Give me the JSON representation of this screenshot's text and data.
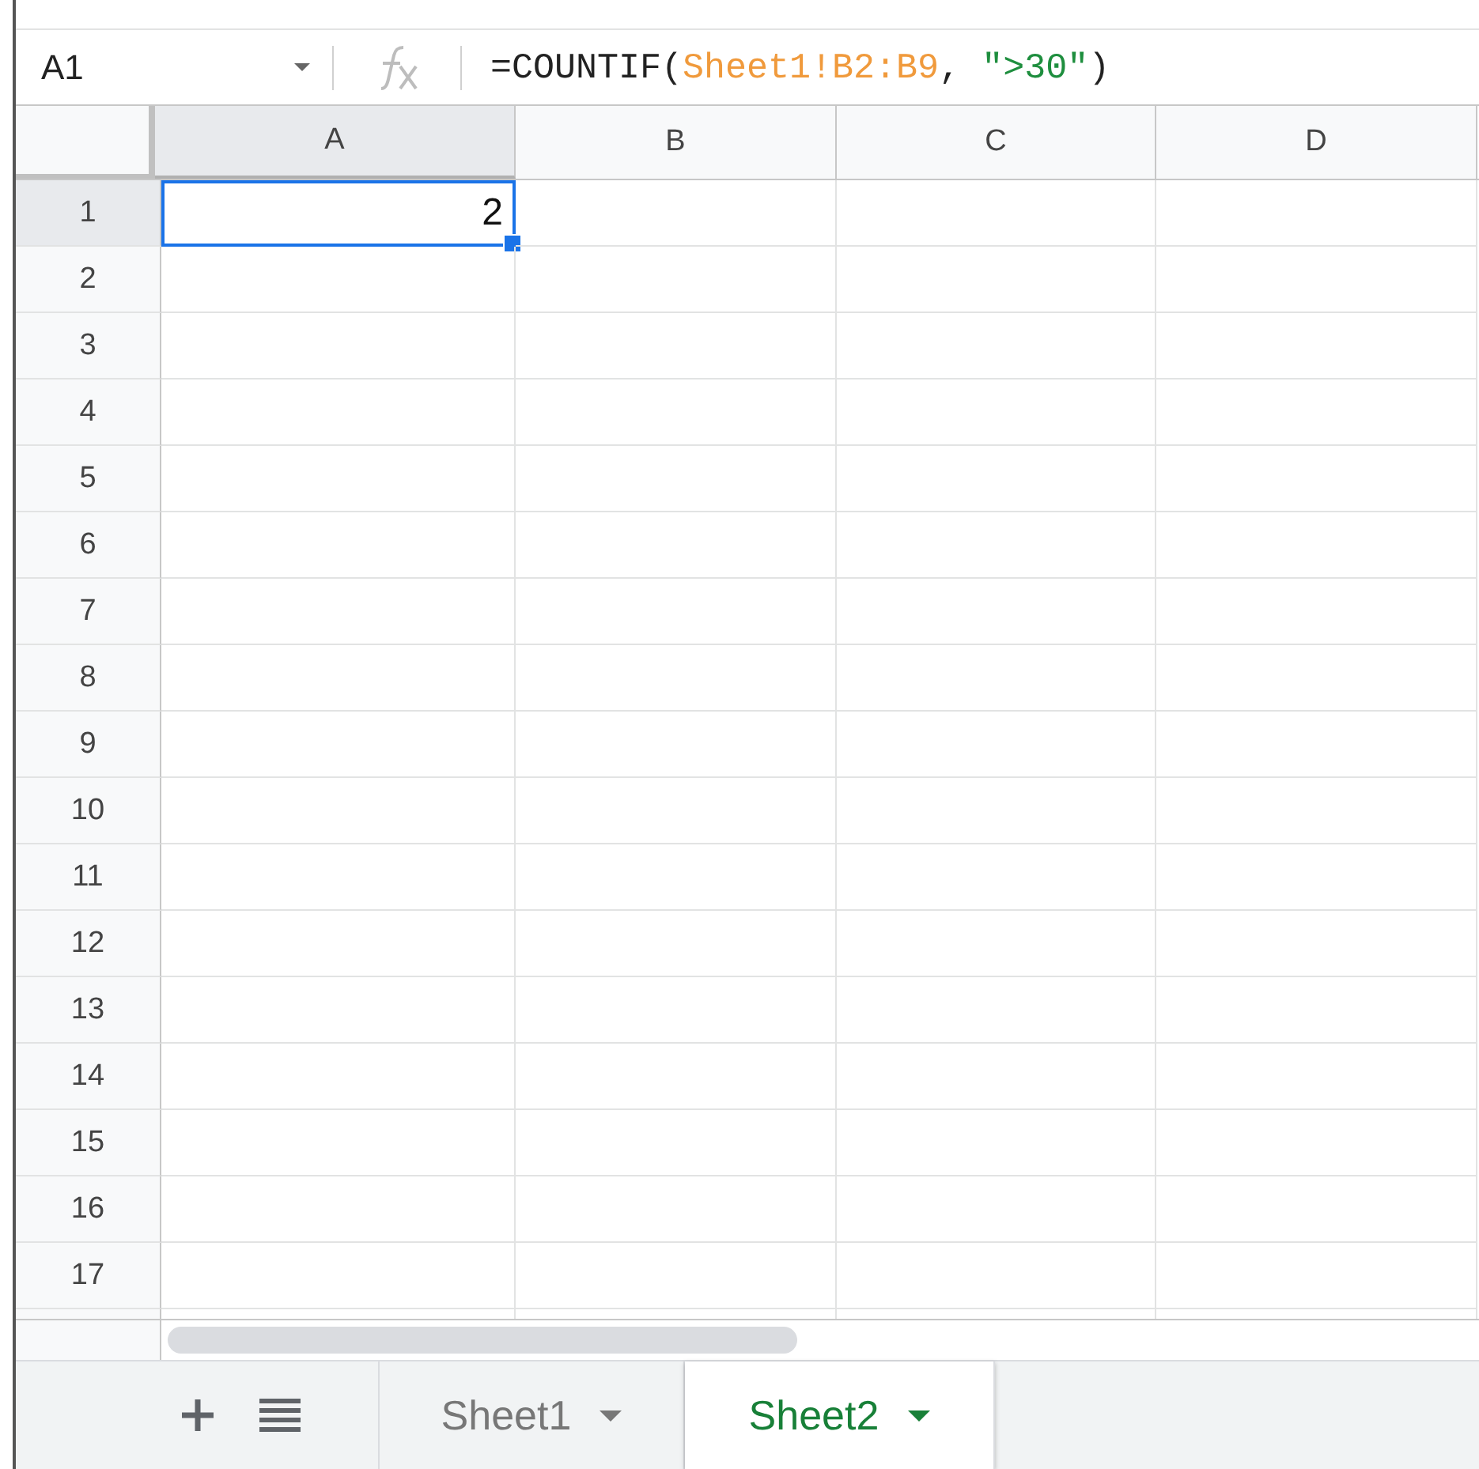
{
  "name_box": {
    "value": "A1"
  },
  "formula_bar": {
    "segments": [
      {
        "kind": "plain",
        "text": "=COUNTIF("
      },
      {
        "kind": "reference",
        "text": "Sheet1!B2:B9"
      },
      {
        "kind": "plain",
        "text": ", "
      },
      {
        "kind": "string",
        "text": "\">30\""
      },
      {
        "kind": "plain",
        "text": ")"
      }
    ]
  },
  "columns": [
    {
      "label": "A",
      "selected": true
    },
    {
      "label": "B",
      "selected": false
    },
    {
      "label": "C",
      "selected": false
    },
    {
      "label": "D",
      "selected": false
    }
  ],
  "rows": [
    {
      "label": "1",
      "selected": true,
      "cells": [
        {
          "value": "2",
          "selected": true
        }
      ]
    },
    {
      "label": "2",
      "selected": false
    },
    {
      "label": "3",
      "selected": false
    },
    {
      "label": "4",
      "selected": false
    },
    {
      "label": "5",
      "selected": false
    },
    {
      "label": "6",
      "selected": false
    },
    {
      "label": "7",
      "selected": false
    },
    {
      "label": "8",
      "selected": false
    },
    {
      "label": "9",
      "selected": false
    },
    {
      "label": "10",
      "selected": false
    },
    {
      "label": "11",
      "selected": false
    },
    {
      "label": "12",
      "selected": false
    },
    {
      "label": "13",
      "selected": false
    },
    {
      "label": "14",
      "selected": false
    },
    {
      "label": "15",
      "selected": false
    },
    {
      "label": "16",
      "selected": false
    },
    {
      "label": "17",
      "selected": false
    }
  ],
  "sheet_tabs": [
    {
      "label": "Sheet1",
      "selected": false
    },
    {
      "label": "Sheet2",
      "selected": true
    }
  ]
}
